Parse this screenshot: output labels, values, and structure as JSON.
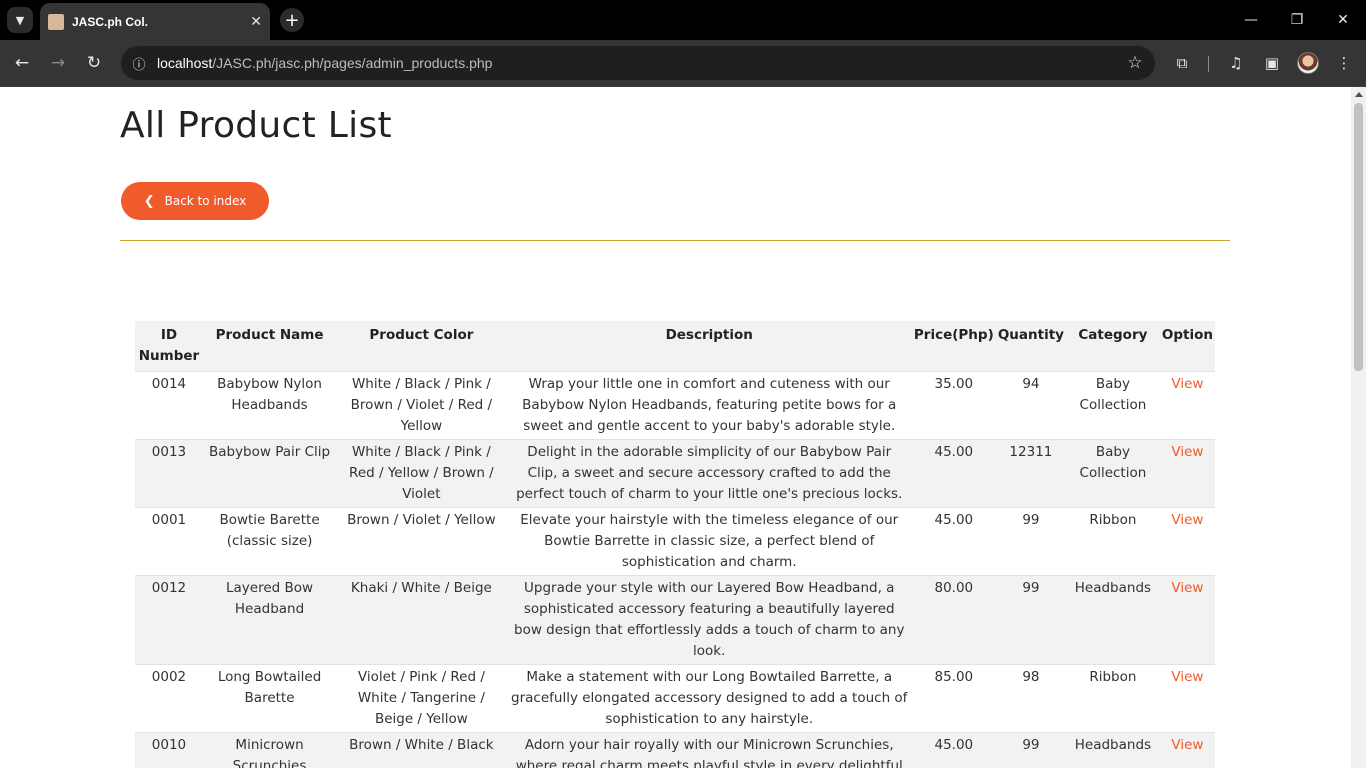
{
  "browser": {
    "tab_title": "JASC.ph Col.",
    "url_host": "localhost",
    "url_path": "/JASC.ph/jasc.ph/pages/admin_products.php",
    "icons": {
      "tab_search": "chevron-down-icon",
      "close": "close-icon",
      "new_tab": "plus-icon",
      "back": "arrow-left-icon",
      "forward": "arrow-right-icon",
      "reload": "reload-icon",
      "info": "info-icon",
      "star": "star-icon",
      "extensions": "puzzle-icon",
      "media": "media-control-icon",
      "sidepanel": "side-panel-icon",
      "menu": "kebab-menu-icon"
    }
  },
  "page": {
    "title": "All Product List",
    "back_label": "Back to index",
    "accent_color": "#f15a2b",
    "divider_color": "#c9a52c"
  },
  "table": {
    "headers": [
      "ID Number",
      "Product Name",
      "Product Color",
      "Description",
      "Price(Php)",
      "Quantity",
      "Category",
      "Option"
    ],
    "rows": [
      {
        "id": "0014",
        "name": "Babybow Nylon Headbands",
        "color": "White / Black / Pink / Brown / Violet / Red / Yellow",
        "description": "Wrap your little one in comfort and cuteness with our Babybow Nylon Headbands, featuring petite bows for a sweet and gentle accent to your baby's adorable style.",
        "price": "35.00",
        "quantity": "94",
        "category": "Baby Collection",
        "option": "View"
      },
      {
        "id": "0013",
        "name": "Babybow Pair Clip",
        "color": "White / Black / Pink / Red / Yellow / Brown / Violet",
        "description": "Delight in the adorable simplicity of our Babybow Pair Clip, a sweet and secure accessory crafted to add the perfect touch of charm to your little one's precious locks.",
        "price": "45.00",
        "quantity": "12311",
        "category": "Baby Collection",
        "option": "View"
      },
      {
        "id": "0001",
        "name": "Bowtie Barette (classic size)",
        "color": "Brown / Violet / Yellow",
        "description": "Elevate your hairstyle with the timeless elegance of our Bowtie Barrette in classic size, a perfect blend of sophistication and charm.",
        "price": "45.00",
        "quantity": "99",
        "category": "Ribbon",
        "option": "View"
      },
      {
        "id": "0012",
        "name": "Layered Bow Headband",
        "color": "Khaki / White / Beige",
        "description": "Upgrade your style with our Layered Bow Headband, a sophisticated accessory featuring a beautifully layered bow design that effortlessly adds a touch of charm to any look.",
        "price": "80.00",
        "quantity": "99",
        "category": "Headbands",
        "option": "View"
      },
      {
        "id": "0002",
        "name": "Long Bowtailed Barette",
        "color": "Violet / Pink / Red / White / Tangerine / Beige / Yellow",
        "description": "Make a statement with our Long Bowtailed Barrette, a gracefully elongated accessory designed to add a touch of sophistication to any hairstyle.",
        "price": "85.00",
        "quantity": "98",
        "category": "Ribbon",
        "option": "View"
      },
      {
        "id": "0010",
        "name": "Minicrown Scrunchies",
        "color": "Brown / White / Black",
        "description": "Adorn your hair royally with our Minicrown Scrunchies, where regal charm meets playful style in every delightful",
        "price": "45.00",
        "quantity": "99",
        "category": "Headbands",
        "option": "View"
      }
    ]
  }
}
